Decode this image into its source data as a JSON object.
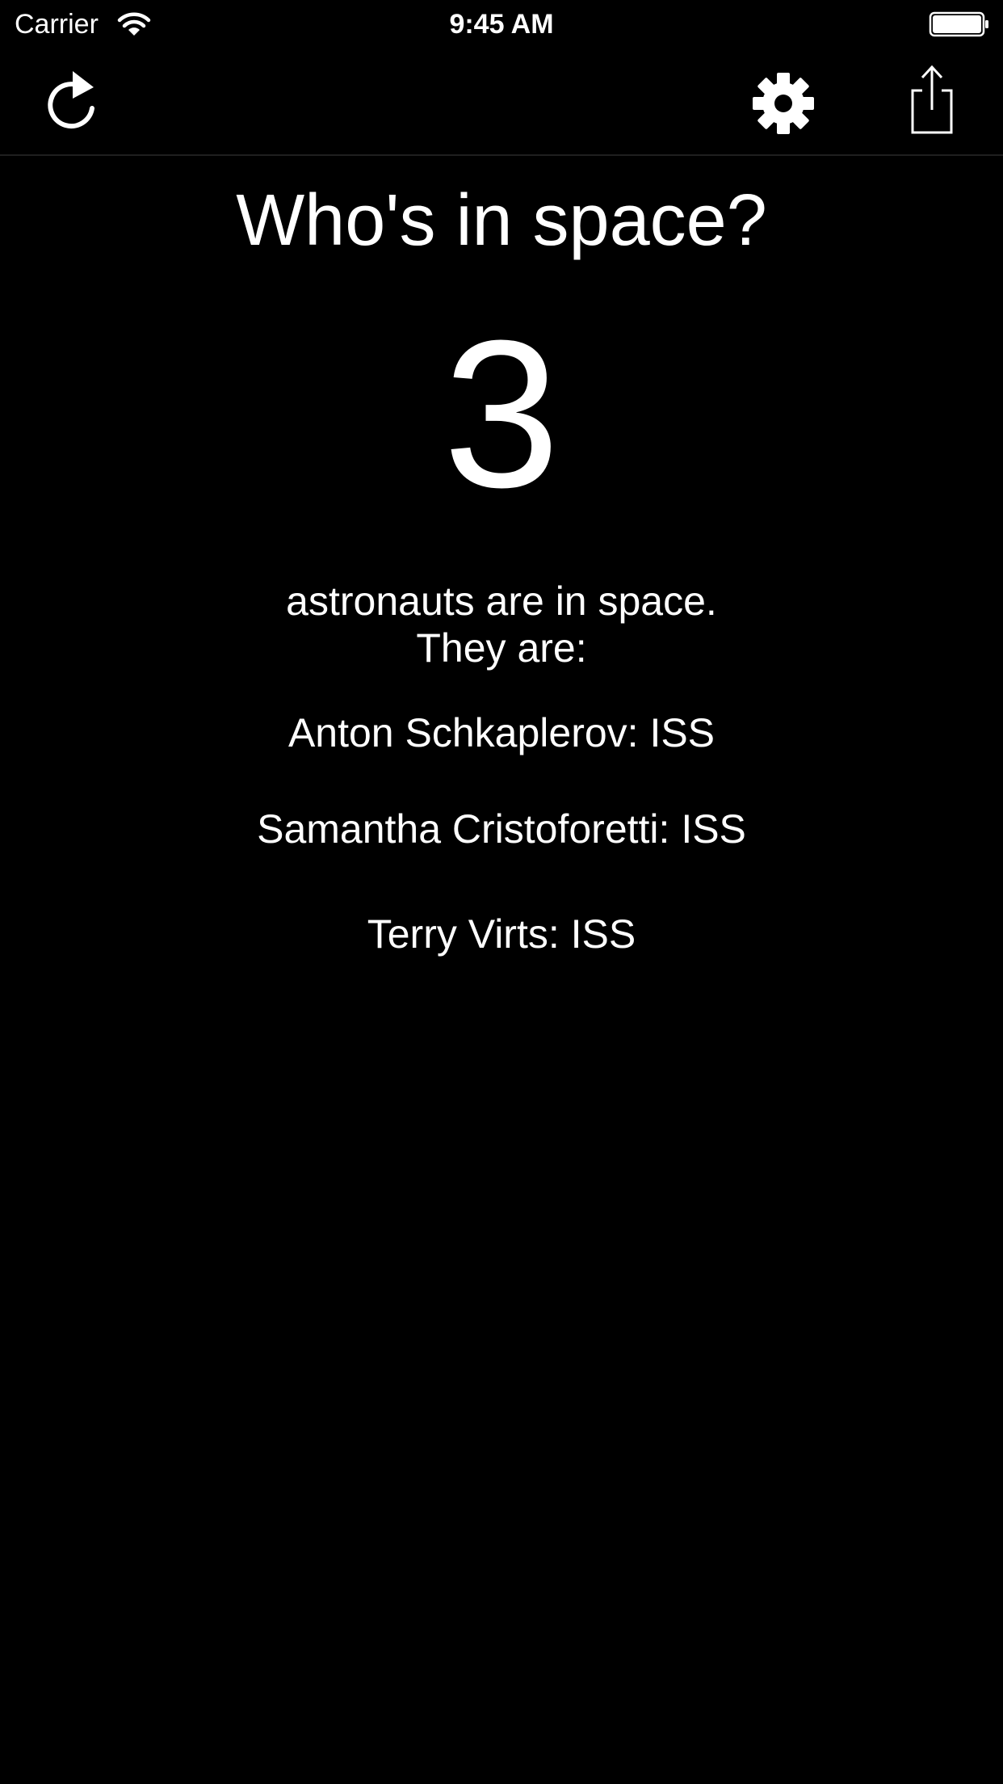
{
  "status_bar": {
    "carrier": "Carrier",
    "time": "9:45 AM"
  },
  "toolbar": {
    "icons": [
      "refresh-icon",
      "gear-icon",
      "share-icon"
    ]
  },
  "main": {
    "title": "Who's in space?",
    "count": "3",
    "summary_line1": "astronauts are in space.",
    "summary_line2": "They are:",
    "astronauts": [
      {
        "text": "Anton Schkaplerov: ISS"
      },
      {
        "text": "Samantha Cristoforetti: ISS"
      },
      {
        "text": "Terry Virts: ISS"
      }
    ]
  },
  "colors": {
    "background": "#000000",
    "text": "#ffffff",
    "divider": "#1f1f1f"
  }
}
